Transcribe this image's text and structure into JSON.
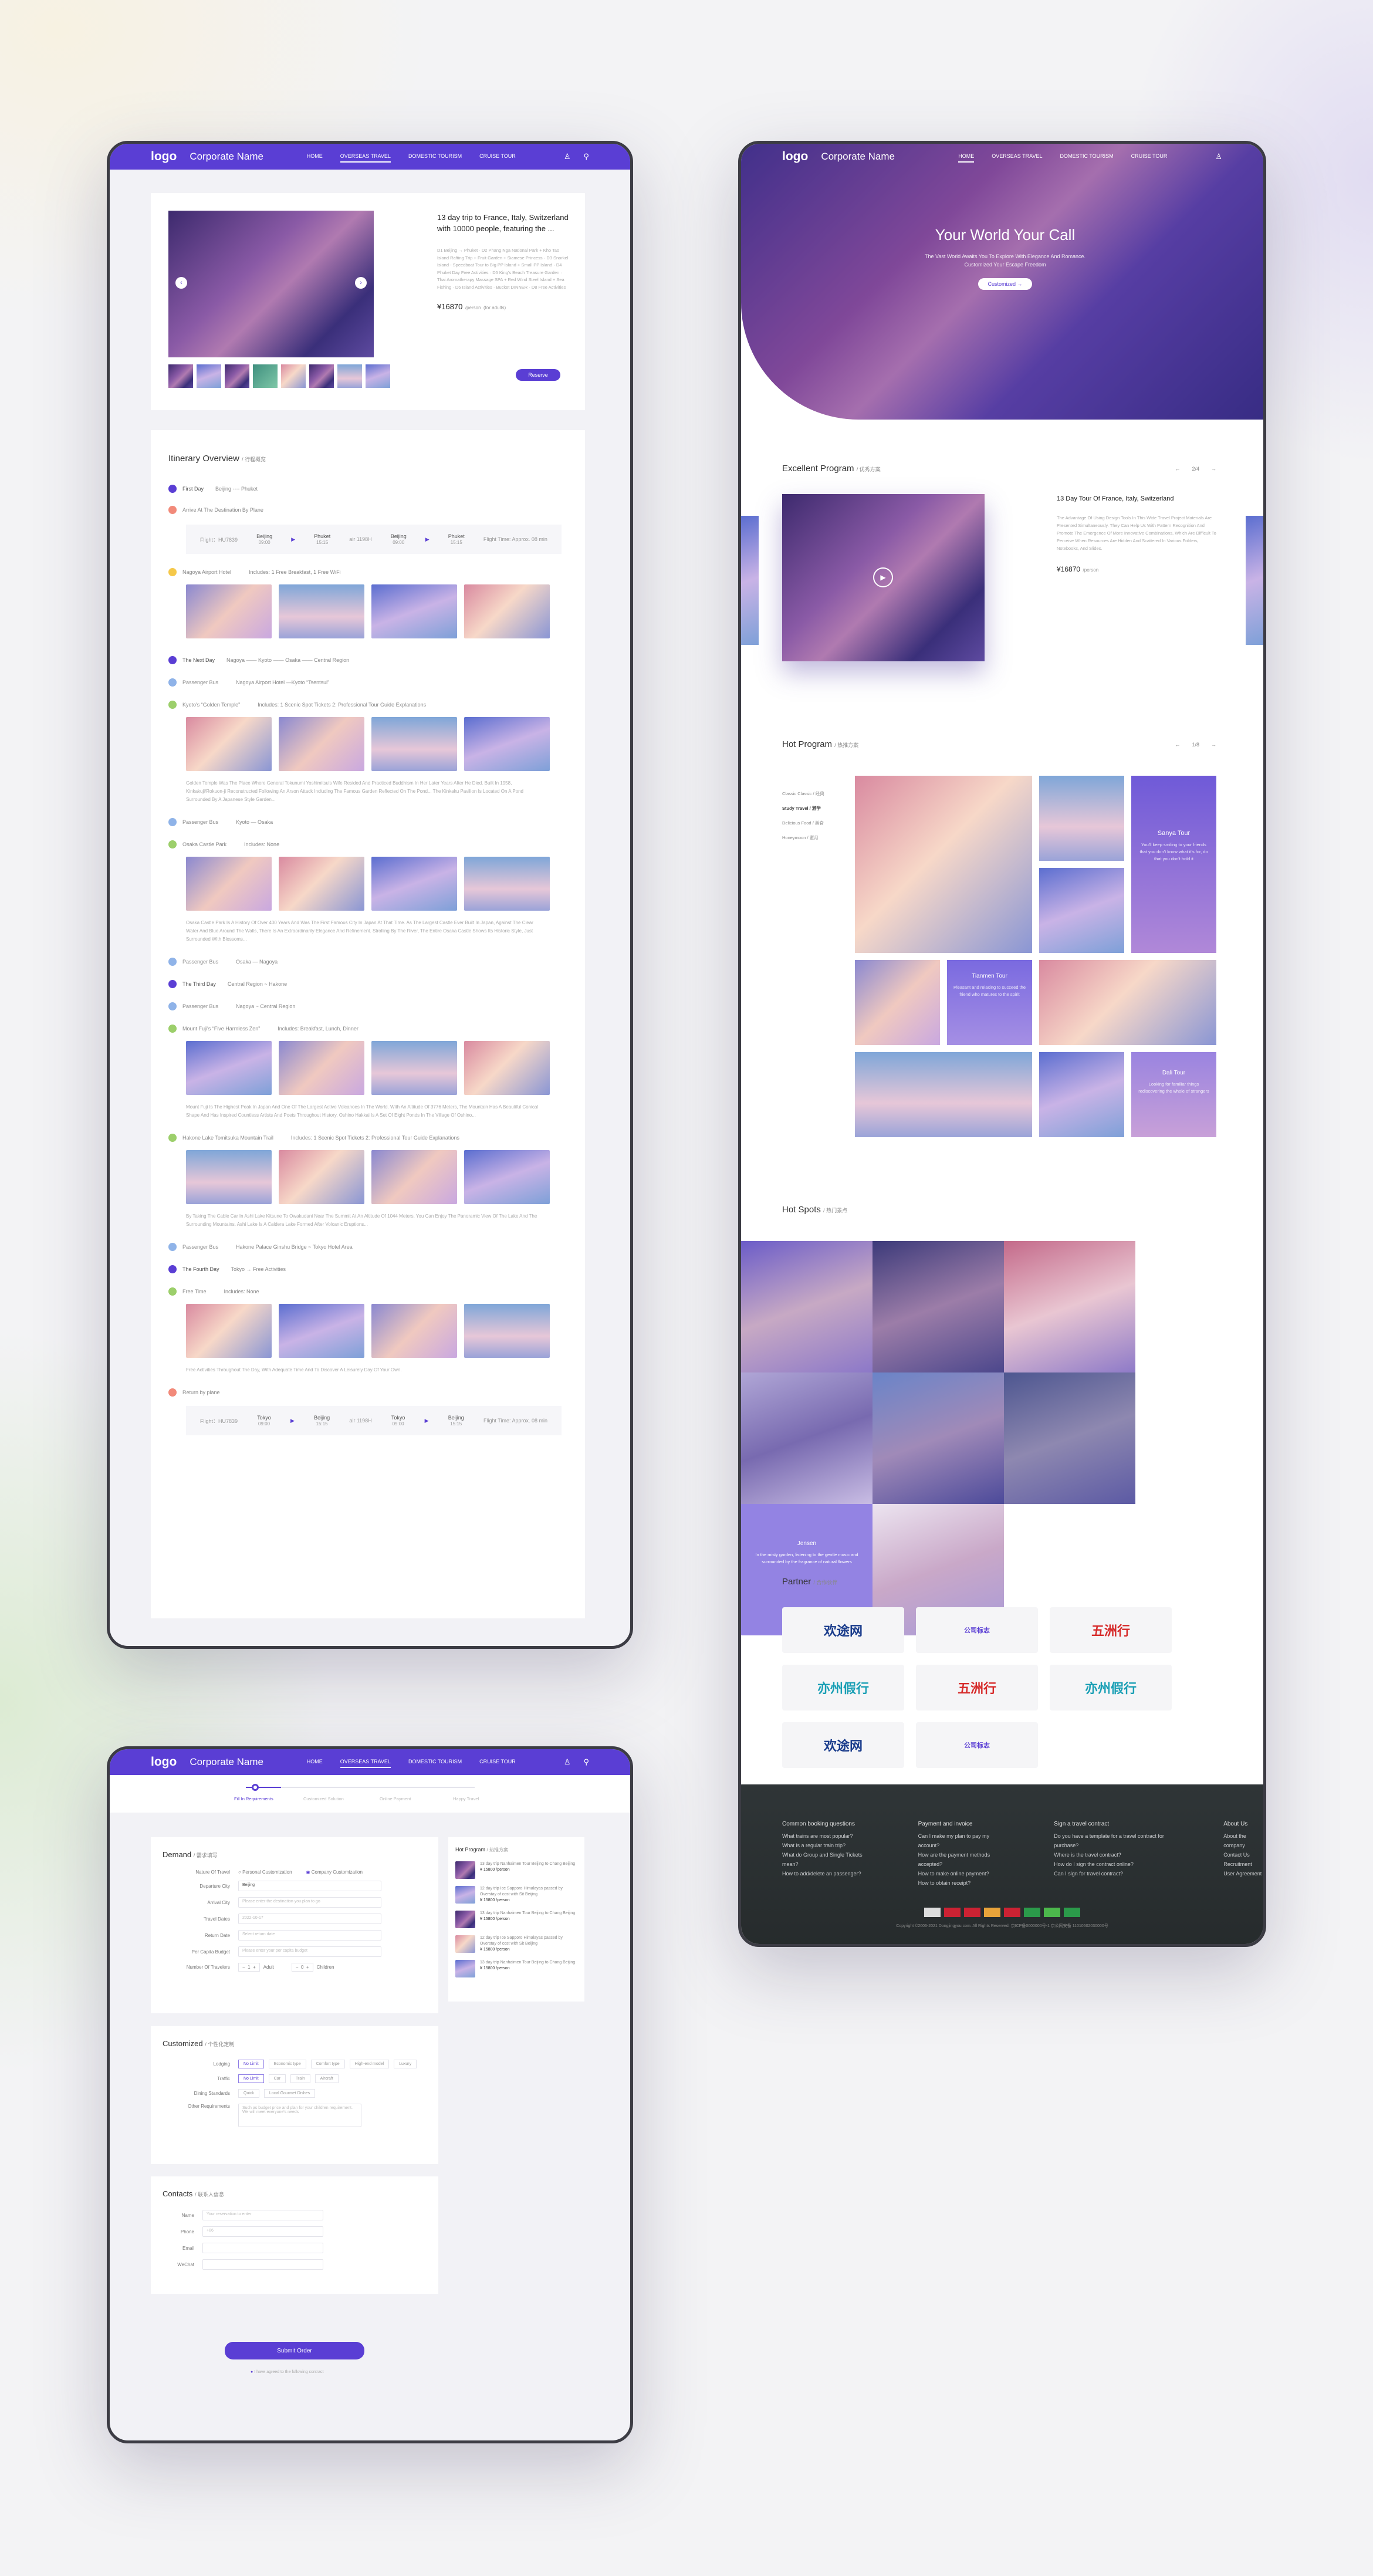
{
  "nav": {
    "logo": "logo",
    "company": "Corporate Name",
    "menu": [
      "HOME",
      "OVERSEAS TRAVEL",
      "DOMESTIC TOURISM",
      "CRUISE TOUR"
    ],
    "active": "OVERSEAS TRAVEL"
  },
  "colors": {
    "primary": "#5a3ed4",
    "footer": "#2d3334"
  },
  "trip": {
    "title": "13 day trip to France, Italy, Switzerland with 10000 people, featuring the ...",
    "desc": "D1 Beijing → Phuket · D2 Phang Nga National Park + Kho Tao Island Rafting Trip + Fruit Garden + Siamese Princess · D3 Snorkel Island - Speedboat Tour to Big PP Island + Small PP Island · D4 Phuket Day Free Activities · D5 King's Beach Treasure Garden · Thai Aromatherapy Massage SPA + Red Wind Steel Island + Sea Fishing · D6 Island Activities · Bucket DINNER · D8 Free Activities",
    "price": "¥16870",
    "price_unit": "/person",
    "price_note": "(for adults)",
    "book": "Reserve"
  },
  "itinerary": {
    "title": "Itinerary Overview",
    "title_cn": "行程概览",
    "day1": "First Day",
    "day1_route": "Beijing ---- Phuket",
    "arrive": "Arrive At The Destination By Plane",
    "flight1": {
      "no": "Flight：HU7839",
      "from": "Beijing",
      "t1": "09:00",
      "to": "Phuket",
      "t2": "15:15",
      "mid": "air 1198H",
      "from2": "Beijing",
      "t3": "09:00",
      "to2": "Phuket",
      "t4": "15:15",
      "time": "Flight Time: Approx. 08 min"
    },
    "s1": "Nagoya Airport Hotel",
    "s1b": "Includes: 1 Free Breakfast, 1 Free WiFi",
    "day2": "The Next Day",
    "day2_route": "Nagoya —— Kyoto —— Osaka —— Central Region",
    "bus": "Passenger Bus",
    "bus1": "Nagoya Airport Hotel —Kyoto “Tsentsui”",
    "s2": "Kyoto's “Golden Temple”",
    "s2b": "Includes: 1 Scenic Spot Tickets 2: Professional Tour Guide Explanations",
    "p2": "Golden Temple Was The Place Where General Tokunumi Yoshimitsu's Wife Resided And Practiced Buddhism In Her Later Years After He Died. Built In 1958, Kinkakuji/Rokuon-ji Reconstructed Following An Arson Attack Including The Famous Garden Reflected On The Pond... The Kinkaku Pavilion Is Located On A Pond Surrounded By A Japanese Style Garden...",
    "bus2": "Kyoto — Osaka",
    "s3": "Osaka Castle Park",
    "s3b": "Includes: None",
    "p3": "Osaka Castle Park Is A History Of Over 400 Years And Was The First Famous City In Japan At That Time. As The Largest Castle Ever Built In Japan, Against The Clear Water And Blue Around The Walls, There Is An Extraordinarily Elegance And Refinement. Strolling By The River, The Entire Osaka Castle Shows Its Historic Style, Just Surrounded With Blossoms...",
    "bus3": "Osaka — Nagoya",
    "day3": "The Third Day",
    "day3_route": "Central Region ~ Hakone",
    "bus4": "Nagoya ~ Central Region",
    "s4": "Mount Fuji's “Five Harmless Zen”",
    "s4b": "Includes: Breakfast, Lunch, Dinner",
    "p4": "Mount Fuji Is The Highest Peak In Japan And One Of The Largest Active Volcanoes In The World. With An Altitude Of 3776 Meters, The Mountain Has A Beautiful Conical Shape And Has Inspired Countless Artists And Poets Throughout History. Oshino Hakkai Is A Set Of Eight Ponds In The Village Of Oshino...",
    "s5": "Hakone Lake Tomitsuka Mountain Trail",
    "s5b": "Includes: 1 Scenic Spot Tickets 2: Professional Tour Guide Explanations",
    "p5": "By Taking The Cable Car In Ashi Lake Kitsune To Owakudani Near The Summit At An Altitude Of 1044 Meters, You Can Enjoy The Panoramic View Of The Lake And The Surrounding Mountains. Ashi Lake Is A Caldera Lake Formed After Volcanic Eruptions...",
    "bus5": "Hakone Palace Ginshu Bridge ~ Tokyo Hotel Area",
    "day4": "The Fourth Day",
    "day4_route": "Tokyo → Free Activities",
    "s6": "Free Time",
    "s6b": "Includes: None",
    "p6": "Free Activities Throughout The Day, With Adequate Time And To Discover A Leisurely Day Of Your Own.",
    "return": "Return by plane",
    "flight2": {
      "no": "Flight：HU7839",
      "from": "Tokyo",
      "t1": "09:00",
      "to": "Beijing",
      "t2": "15:15",
      "mid": "air 1198H",
      "from2": "Tokyo",
      "t3": "09:00",
      "to2": "Beijing",
      "t4": "15:15",
      "time": "Flight Time: Approx. 08 min"
    }
  },
  "hero": {
    "title": "Your World  Your Call",
    "sub": "The Vast World Awaits You To Explore With Elegance And Romance. Customized Your Escape Freedom",
    "btn": "Customized"
  },
  "excellent": {
    "title": "Excellent Program",
    "cn": "优秀方案",
    "page": "2/4",
    "name": "13 Day Tour Of France, Italy, Switzerland",
    "text": "The Advantage Of Using Design Tools In This Wide Travel Project Materials Are Presented Simultaneously. They Can Help Us With Pattern Recognition And Promote The Emergence Of More Innovative Combinations, Which Are Difficult To Perceive When Resources Are Hidden And Scattered In Various Folders, Notebooks, And Slides.",
    "price": "¥16870",
    "unit": "/person"
  },
  "hot": {
    "title": "Hot Program",
    "cn": "热推方案",
    "page": "1/8",
    "cats": [
      "Classic Classic / 经典",
      "Study Travel / 游学",
      "Delicious Food / 美食",
      "Honeymoon / 蜜月"
    ],
    "active": "Study Travel / 游学",
    "t1": "Sanya Tour",
    "t1d": "You'll keep smiling to your friends that you don't know what it's for, do that you don't hold it",
    "t2": "Tianmen Tour",
    "t2d": "Pleasant and relaxing to succeed the friend who matures to the spirit",
    "t3": "Dali Tour",
    "t3d": "Looking for familiar things rediscovering the whole of strangers"
  },
  "spots": {
    "title": "Hot Spots",
    "cn": "热门景点",
    "name": "Jensen",
    "desc": "In the misty garden, listening to the gentle music and surrounded by the fragrance of natural flowers"
  },
  "partner": {
    "title": "Partner",
    "cn": "合作伙伴",
    "logos": [
      "欢途网",
      "公司标志",
      "五洲行",
      "亦州假行",
      "五洲行",
      "亦州假行",
      "欢途网",
      "公司标志"
    ]
  },
  "footer": {
    "c1": "Common booking questions",
    "c1i": [
      "What trains are most popular?",
      "What is a regular train trip?",
      "What do Group and Single Tickets mean?",
      "How to add/delete an passenger?"
    ],
    "c2": "Payment and invoice",
    "c2i": [
      "Can I make my plan to pay my account?",
      "How are the payment methods accepted?",
      "How to make online payment?",
      "How to obtain receipt?"
    ],
    "c3": "Sign a travel contract",
    "c3i": [
      "Do you have a template for a travel contract for purchase?",
      "Where is the travel contract?",
      "How do I sign the contract online?",
      "Can I sign for travel contract?"
    ],
    "c4": "About Us",
    "c4i": [
      "About the company",
      "Contact Us",
      "Recruitment",
      "User Agreement"
    ],
    "copy": "Copyright ©2006-2021 Dongjingyou.com. All Rights Reserved. 京ICP备0000000号-1 京公网安备 11010502030000号"
  },
  "order": {
    "steps": [
      "Fill In Requirements",
      "Customized Solution",
      "Online Payment",
      "Happy Travel"
    ],
    "demand": "Demand",
    "demand_cn": "需求填写",
    "nature": "Nature Of Travel",
    "opt1": "Personal Customization",
    "opt2": "Company Customization",
    "f_dep": "Departure City",
    "f_dep_v": "Beijing",
    "f_arr": "Arrival City",
    "f_arr_p": "Please enter the destination you plan to go",
    "f_time": "Travel Dates",
    "f_time_p": "2022-10-17",
    "f_ret": "Return Date",
    "f_ret_p": "Select return date",
    "f_budget": "Per Capita Budget",
    "f_budget_p": "Please enter your per capita budget",
    "f_num": "Number Of Travelers",
    "adult": "Adult",
    "child": "Children",
    "hotprog": "Hot Program",
    "hotprog_cn": "热推方案",
    "hp": [
      "13 day trip Nanhaimen Tour Beijing to Chang Beijing",
      "12 day trip Ice Sapporo Himalayas passed by Overstay of cost with Sit Beijing",
      "13 day trip Nanhaimen Tour Beijing to Chang Beijing",
      "12 day trip Ice Sapporo Himalayas passed by Overstay of cost with Sit Beijing",
      "13 day trip Nanhaimen Tour Beijing to Chang Beijing"
    ],
    "hp_price": "¥ 15800 /person",
    "cust": "Customized",
    "cust_cn": "个性化定制",
    "lodging": "Lodging",
    "lodge_opts": [
      "No Limit",
      "Economic type",
      "Comfort type",
      "High-end model",
      "Luxury"
    ],
    "traffic": "Traffic",
    "traffic_opts": [
      "No Limit",
      "Car",
      "Train",
      "Aircraft"
    ],
    "dining": "Dining Standards",
    "dining_opts": [
      "Quick",
      "Local Gourmet Dishes"
    ],
    "other": "Other Requirements",
    "other_p": "Such as budget price and plan for your children requirement. We will meet everyone's needs",
    "contacts": "Contacts",
    "contacts_cn": "联系人信息",
    "name": "Name",
    "name_p": "Your reservation to enter",
    "phone": "Phone",
    "phone_p": "+86",
    "email": "Email",
    "wechat": "WeChat",
    "submit": "Submit Order",
    "agree": "I have agreed to the following contract"
  }
}
